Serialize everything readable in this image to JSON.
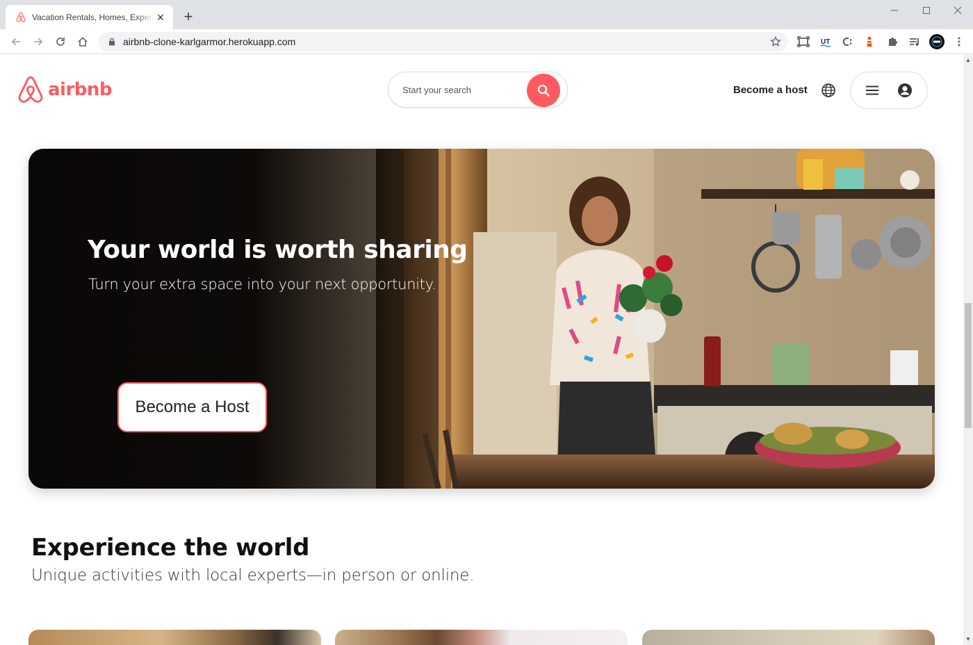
{
  "browser": {
    "tab_title": "Vacation Rentals, Homes, Experiences & Places - Airbnb",
    "url": "airbnb-clone-karlgarmor.herokuapp.com",
    "extensions": [
      "screenshot-icon",
      "ut-extension-icon",
      "c-extension-icon",
      "lighthouse-icon",
      "puzzle-icon",
      "media-queue-icon",
      "profile-avatar"
    ]
  },
  "header": {
    "logo_text": "airbnb",
    "search_placeholder": "Start your search",
    "become_host_link": "Become a host"
  },
  "hero": {
    "title": "Your world is worth sharing",
    "subtitle": "Turn your extra space into your next opportunity.",
    "button_label": "Become a Host"
  },
  "experience": {
    "title": "Experience the world",
    "subtitle": "Unique activities with local experts—in person or online."
  },
  "colors": {
    "brand": "#ff5a5f",
    "text": "#222222",
    "chrome": "#dee1e6"
  }
}
